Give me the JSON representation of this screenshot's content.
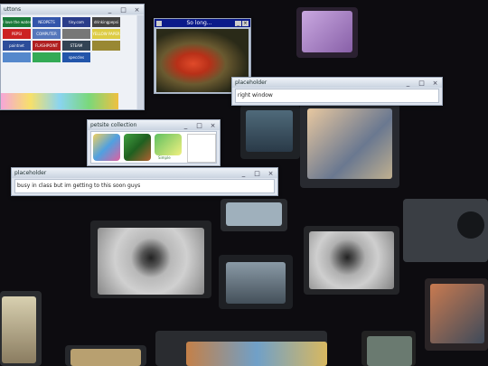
{
  "windows": {
    "buttons": {
      "title": "uttons"
    },
    "pet": {
      "title": "So long..."
    },
    "right": {
      "title": "placeholder",
      "text": "right window"
    },
    "petsite": {
      "title": "petsite collection",
      "caption": "Simple"
    },
    "busy": {
      "title": "placeholder",
      "text": "busy in class but im getting to this soon guys"
    }
  },
  "badges": [
    {
      "label": "I love the water!",
      "color": "#1a7a3a"
    },
    {
      "label": "NEOPETS",
      "color": "#3355aa"
    },
    {
      "label": "tiny.com",
      "color": "#2a3c8a"
    },
    {
      "label": "drinkingpepsi",
      "color": "#444444"
    },
    {
      "label": "PEPSI",
      "color": "#cc2222"
    },
    {
      "label": "COMPUTER",
      "color": "#5577bb"
    },
    {
      "label": "",
      "color": "#777777"
    },
    {
      "label": "YELLOW PAPER",
      "color": "#ddcc44"
    },
    {
      "label": "paintnet",
      "color": "#2c4d9a"
    },
    {
      "label": "FLASHPOINT",
      "color": "#b02020"
    },
    {
      "label": "STEAM",
      "color": "#334455"
    },
    {
      "label": "",
      "color": "#998833"
    },
    {
      "label": "",
      "color": "#5588cc"
    },
    {
      "label": "",
      "color": "#33aa55"
    },
    {
      "label": "speccles",
      "color": "#2255aa"
    }
  ],
  "controls": {
    "minimize": "_",
    "maximize": "□",
    "close": "×"
  },
  "colors": {
    "title_bar": "#c9d3e0",
    "pet_title": "#0a1a8a",
    "desktop": "#0d0c10"
  }
}
